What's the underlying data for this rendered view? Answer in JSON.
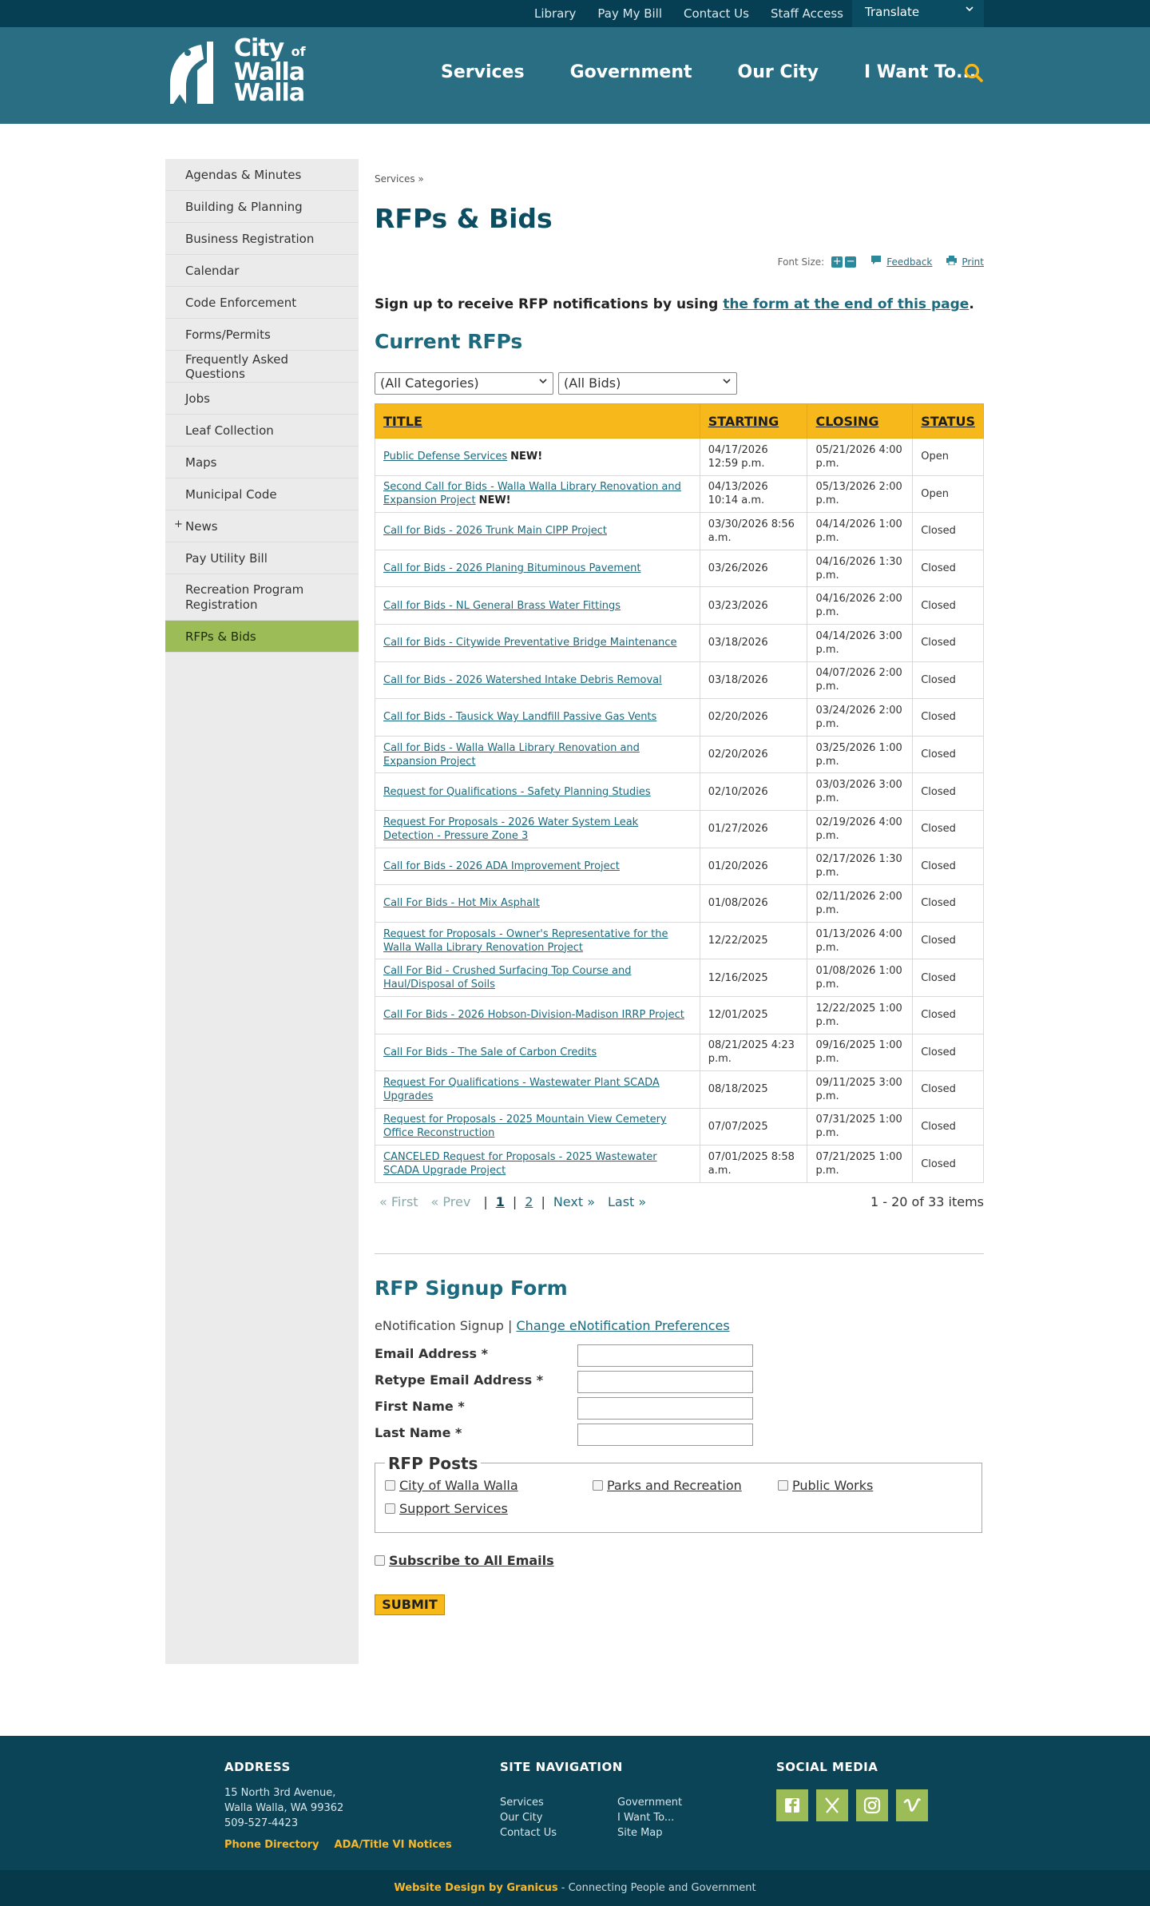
{
  "utility": {
    "links": [
      "Library",
      "Pay My Bill",
      "Contact Us",
      "Staff Access"
    ],
    "translate": "Translate"
  },
  "logo": {
    "line1": "City",
    "of": "of",
    "line2": "Walla",
    "line3": "Walla"
  },
  "nav": [
    "Services",
    "Government",
    "Our City",
    "I Want To..."
  ],
  "sidebar": {
    "items": [
      "Agendas & Minutes",
      "Building & Planning",
      "Business Registration",
      "Calendar",
      "Code Enforcement",
      "Forms/Permits",
      "Frequently Asked Questions",
      "Jobs",
      "Leaf Collection",
      "Maps",
      "Municipal Code",
      "News",
      "Pay Utility Bill",
      "Recreation Program Registration",
      "RFPs & Bids"
    ],
    "expand_symbol": "+",
    "active_index": 14
  },
  "breadcrumb": "Services »",
  "page_title": "RFPs & Bids",
  "tools": {
    "font_size_label": "Font Size:",
    "increase": "+",
    "decrease": "−",
    "feedback": "Feedback",
    "print": "Print"
  },
  "signup_note": {
    "prefix": "Sign up to receive RFP notifications by using ",
    "link": "the form at the end of this page",
    "suffix": "."
  },
  "current_rfps_title": "Current RFPs",
  "filters": {
    "category": "(All Categories)",
    "bids": "(All Bids)"
  },
  "table": {
    "headers": [
      "TITLE",
      "STARTING",
      "CLOSING",
      "STATUS"
    ],
    "new_label": "NEW!",
    "rows": [
      {
        "title": "Public Defense Services",
        "new": true,
        "starting": "04/17/2026 12:59 p.m.",
        "closing": "05/21/2026 4:00 p.m.",
        "status": "Open"
      },
      {
        "title": "Second Call for Bids - Walla Walla Library Renovation and Expansion Project",
        "new": true,
        "starting": "04/13/2026 10:14 a.m.",
        "closing": "05/13/2026 2:00 p.m.",
        "status": "Open"
      },
      {
        "title": "Call for Bids - 2026 Trunk Main CIPP Project",
        "new": false,
        "starting": "03/30/2026 8:56 a.m.",
        "closing": "04/14/2026 1:00 p.m.",
        "status": "Closed"
      },
      {
        "title": "Call for Bids - 2026 Planing Bituminous Pavement",
        "new": false,
        "starting": "03/26/2026",
        "closing": "04/16/2026 1:30 p.m.",
        "status": "Closed"
      },
      {
        "title": "Call for Bids - NL General Brass Water Fittings",
        "new": false,
        "starting": "03/23/2026",
        "closing": "04/16/2026 2:00 p.m.",
        "status": "Closed"
      },
      {
        "title": "Call for Bids - Citywide Preventative Bridge Maintenance",
        "new": false,
        "starting": "03/18/2026",
        "closing": "04/14/2026 3:00 p.m.",
        "status": "Closed"
      },
      {
        "title": "Call for Bids - 2026 Watershed Intake Debris Removal",
        "new": false,
        "starting": "03/18/2026",
        "closing": "04/07/2026 2:00 p.m.",
        "status": "Closed"
      },
      {
        "title": "Call for Bids - Tausick Way Landfill Passive Gas Vents",
        "new": false,
        "starting": "02/20/2026",
        "closing": "03/24/2026 2:00 p.m.",
        "status": "Closed"
      },
      {
        "title": "Call for Bids - Walla Walla Library Renovation and Expansion Project",
        "new": false,
        "starting": "02/20/2026",
        "closing": "03/25/2026 1:00 p.m.",
        "status": "Closed"
      },
      {
        "title": "Request for Qualifications - Safety Planning Studies",
        "new": false,
        "starting": "02/10/2026",
        "closing": "03/03/2026 3:00 p.m.",
        "status": "Closed"
      },
      {
        "title": "Request For Proposals - 2026 Water System Leak Detection - Pressure Zone 3",
        "new": false,
        "starting": "01/27/2026",
        "closing": "02/19/2026 4:00 p.m.",
        "status": "Closed"
      },
      {
        "title": "Call for Bids - 2026 ADA Improvement Project",
        "new": false,
        "starting": "01/20/2026",
        "closing": "02/17/2026 1:30 p.m.",
        "status": "Closed"
      },
      {
        "title": "Call For Bids - Hot Mix Asphalt",
        "new": false,
        "starting": "01/08/2026",
        "closing": "02/11/2026 2:00 p.m.",
        "status": "Closed"
      },
      {
        "title": "Request for Proposals - Owner's Representative for the Walla Walla Library Renovation Project",
        "new": false,
        "starting": "12/22/2025",
        "closing": "01/13/2026 4:00 p.m.",
        "status": "Closed"
      },
      {
        "title": "Call For Bid - Crushed Surfacing Top Course and Haul/Disposal of Soils",
        "new": false,
        "starting": "12/16/2025",
        "closing": "01/08/2026 1:00 p.m.",
        "status": "Closed"
      },
      {
        "title": "Call For Bids - 2026 Hobson-Division-Madison IRRP Project",
        "new": false,
        "starting": "12/01/2025",
        "closing": "12/22/2025 1:00 p.m.",
        "status": "Closed"
      },
      {
        "title": "Call For Bids - The Sale of Carbon Credits",
        "new": false,
        "starting": "08/21/2025 4:23 p.m.",
        "closing": "09/16/2025 1:00 p.m.",
        "status": "Closed"
      },
      {
        "title": "Request For Qualifications - Wastewater Plant SCADA Upgrades",
        "new": false,
        "starting": "08/18/2025",
        "closing": "09/11/2025 3:00 p.m.",
        "status": "Closed"
      },
      {
        "title": "Request for Proposals - 2025 Mountain View Cemetery Office Reconstruction",
        "new": false,
        "starting": "07/07/2025",
        "closing": "07/31/2025 1:00 p.m.",
        "status": "Closed"
      },
      {
        "title": "CANCELED Request for Proposals - 2025 Wastewater SCADA Upgrade Project",
        "new": false,
        "starting": "07/01/2025 8:58 a.m.",
        "closing": "07/21/2025 1:00 p.m.",
        "status": "Closed"
      }
    ]
  },
  "pager": {
    "first": "« First",
    "prev": "« Prev",
    "sep": "|",
    "pages": [
      "1",
      "2"
    ],
    "next": "Next »",
    "last": "Last »",
    "items": "1 - 20 of 33 items"
  },
  "signup_form": {
    "title": "RFP Signup Form",
    "enote_prefix": "eNotification Signup | ",
    "enote_link": "Change eNotification Preferences",
    "fields": [
      "Email Address *",
      "Retype Email Address *",
      "First Name *",
      "Last Name *"
    ],
    "legend": "RFP Posts",
    "checkboxes": [
      "City of Walla Walla",
      "Parks and Recreation",
      "Public Works",
      "Support Services"
    ],
    "subscribe_all": "Subscribe to All Emails",
    "submit": "SUBMIT"
  },
  "footer": {
    "address_title": "ADDRESS",
    "address_lines": [
      "15 North 3rd Avenue,",
      "Walla Walla, WA 99362",
      "509-527-4423"
    ],
    "phone_directory": "Phone Directory",
    "ada": "ADA/Title VI Notices",
    "nav_title": "SITE NAVIGATION",
    "nav_col1": [
      "Services",
      "Our City",
      "Contact Us"
    ],
    "nav_col2": [
      "Government",
      "I Want To...",
      "Site Map"
    ],
    "social_title": "SOCIAL MEDIA",
    "social_icons": [
      "facebook-icon",
      "x-icon",
      "instagram-icon",
      "vimeo-icon"
    ],
    "bottom_by": "Website Design by Granicus",
    "bottom_rest": " - Connecting People and Government"
  },
  "colors": {
    "header": "#2a6e83",
    "accent": "#f7b81c",
    "sidebar_active": "#9bbc56",
    "footer": "#0b4457"
  }
}
